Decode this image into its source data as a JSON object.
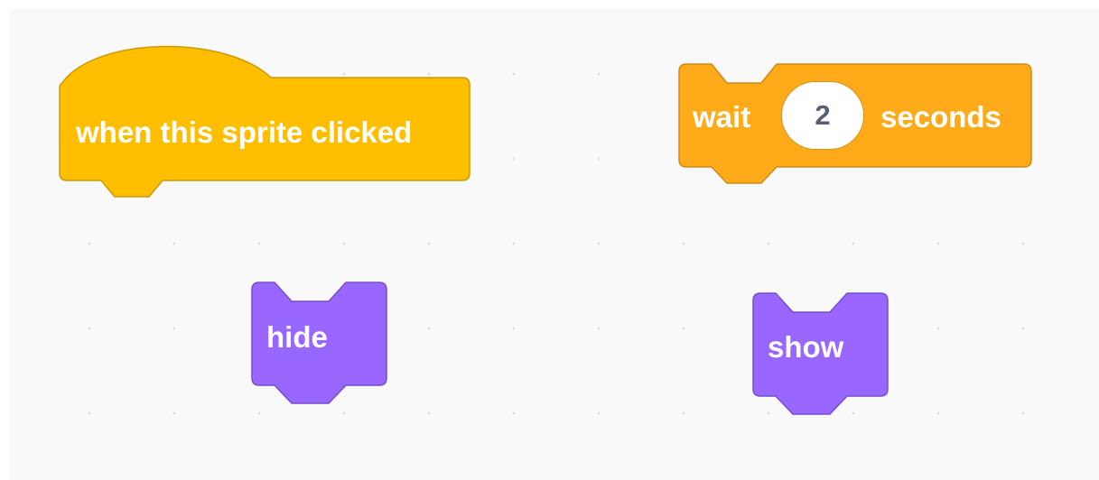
{
  "workspace": {
    "background": "#f9f9f9",
    "grid_dot_color": "#d9d9d9"
  },
  "blocks": {
    "event_when_clicked": {
      "category": "events",
      "label": "when this sprite clicked",
      "fill": "#ffbf00",
      "stroke": "#cc9900"
    },
    "control_wait": {
      "category": "control",
      "label_before": "wait",
      "input_value": "2",
      "label_after": "seconds",
      "fill": "#ffab19",
      "stroke": "#cf8b17"
    },
    "looks_hide": {
      "category": "looks",
      "label": "hide",
      "fill": "#9966ff",
      "stroke": "#774dcb"
    },
    "looks_show": {
      "category": "looks",
      "label": "show",
      "fill": "#9966ff",
      "stroke": "#774dcb"
    }
  }
}
